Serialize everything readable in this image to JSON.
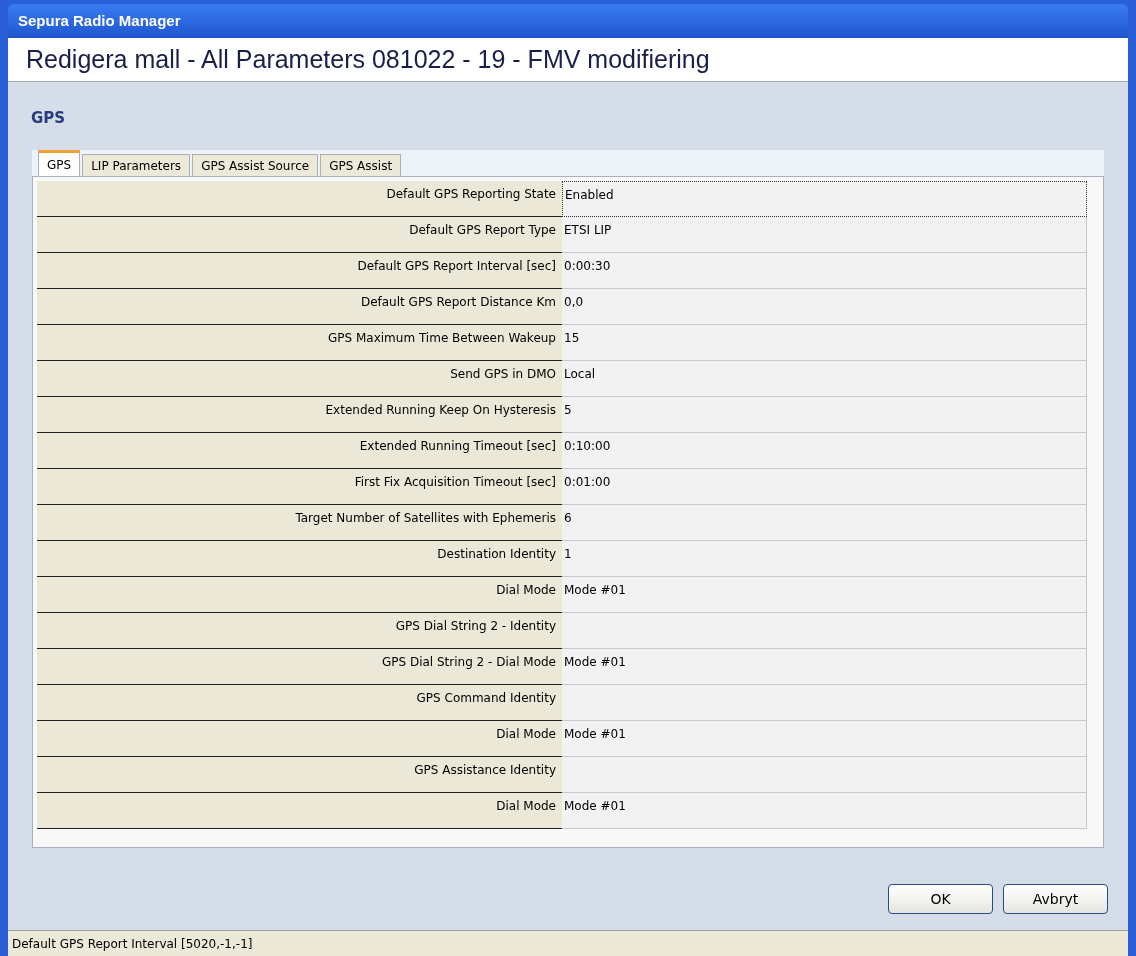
{
  "window": {
    "title": "Sepura Radio Manager"
  },
  "heading": "Redigera mall - All Parameters 081022 - 19 - FMV modifiering",
  "section_title": "GPS",
  "tabs": [
    {
      "label": "GPS",
      "selected": true
    },
    {
      "label": "LIP Parameters",
      "selected": false
    },
    {
      "label": "GPS Assist Source",
      "selected": false
    },
    {
      "label": "GPS Assist",
      "selected": false
    }
  ],
  "rows": [
    {
      "label": "Default GPS Reporting State",
      "value": "Enabled",
      "focused": true
    },
    {
      "label": "Default GPS Report Type",
      "value": "ETSI LIP",
      "focused": false
    },
    {
      "label": "Default GPS Report Interval [sec]",
      "value": "0:00:30",
      "focused": false
    },
    {
      "label": "Default GPS Report Distance Km",
      "value": "0,0",
      "focused": false
    },
    {
      "label": "GPS Maximum Time Between Wakeup",
      "value": "15",
      "focused": false
    },
    {
      "label": "Send GPS in DMO",
      "value": "Local",
      "focused": false
    },
    {
      "label": "Extended Running Keep On Hysteresis",
      "value": "5",
      "focused": false
    },
    {
      "label": "Extended Running Timeout [sec]",
      "value": "0:10:00",
      "focused": false
    },
    {
      "label": "First Fix Acquisition Timeout [sec]",
      "value": "0:01:00",
      "focused": false
    },
    {
      "label": "Target Number of Satellites with Ephemeris",
      "value": "6",
      "focused": false
    },
    {
      "label": "Destination Identity",
      "value": "1",
      "focused": false
    },
    {
      "label": "Dial Mode",
      "value": "Mode #01",
      "focused": false
    },
    {
      "label": "GPS Dial String 2 - Identity",
      "focused": false
    },
    {
      "label": "GPS Dial String 2 - Dial Mode",
      "value": "Mode #01",
      "focused": false
    },
    {
      "label": "GPS Command Identity",
      "focused": false
    },
    {
      "label": "Dial Mode",
      "value": "Mode #01",
      "focused": false
    },
    {
      "label": "GPS Assistance Identity",
      "focused": false
    },
    {
      "label": "Dial Mode",
      "value": "Mode #01",
      "focused": false
    }
  ],
  "buttons": [
    "OK",
    "Avbryt"
  ],
  "status_bar": "Default GPS Report Interval [5020,-1,-1]"
}
